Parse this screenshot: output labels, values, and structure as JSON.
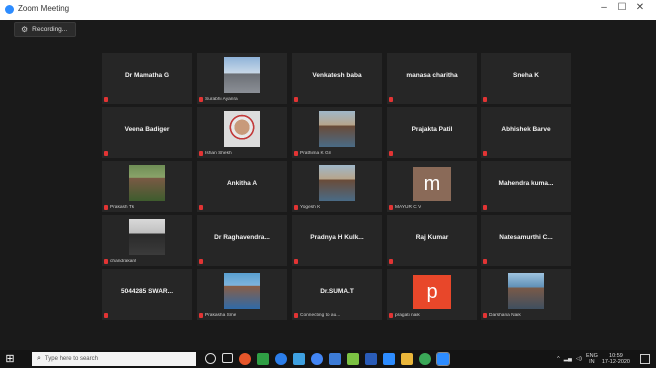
{
  "window": {
    "title": "Zoom Meeting",
    "minimize": "–",
    "maximize": "☐",
    "close": "✕"
  },
  "recording": {
    "label": "Recording..."
  },
  "tiles": [
    {
      "name": "Dr Mamatha G",
      "caption": "",
      "video": ""
    },
    {
      "name": "",
      "caption": "Surabhi Ayanra",
      "video": "tower"
    },
    {
      "name": "Venkatesh baba",
      "caption": "",
      "video": ""
    },
    {
      "name": "manasa charitha",
      "caption": "",
      "video": ""
    },
    {
      "name": "Sneha K",
      "caption": "",
      "video": ""
    },
    {
      "name": "Veena Badiger",
      "caption": "",
      "video": ""
    },
    {
      "name": "",
      "caption": "Ishan Shekh",
      "video": "portrait-frame"
    },
    {
      "name": "",
      "caption": "Prathima K Gn",
      "video": "portrait-outdoor"
    },
    {
      "name": "Prajakta Patil",
      "caption": "",
      "video": ""
    },
    {
      "name": "Abhishek Barve",
      "caption": "",
      "video": ""
    },
    {
      "name": "",
      "caption": "Prakash Tk",
      "video": "portrait-green"
    },
    {
      "name": "Ankitha A",
      "caption": "",
      "video": ""
    },
    {
      "name": "",
      "caption": "Yogesh K",
      "video": "portrait-outdoor"
    },
    {
      "name": "",
      "caption": "MAYUR C V",
      "video": "letter-m"
    },
    {
      "name": "Mahendra kuma...",
      "caption": "",
      "video": ""
    },
    {
      "name": "",
      "caption": "chandrakant",
      "video": "portrait-dark"
    },
    {
      "name": "Dr Raghavendra...",
      "caption": "",
      "video": ""
    },
    {
      "name": "Pradnya H Kulk...",
      "caption": "",
      "video": ""
    },
    {
      "name": "Raj Kumar",
      "caption": "",
      "video": ""
    },
    {
      "name": "Natesamurthi C...",
      "caption": "",
      "video": ""
    },
    {
      "name": "5044285 SWAR...",
      "caption": "",
      "video": ""
    },
    {
      "name": "",
      "caption": "Prakasha Sme",
      "video": "portrait-blue"
    },
    {
      "name": "Dr.SUMA.T",
      "caption": "Connecting to au...",
      "video": ""
    },
    {
      "name": "",
      "caption": "pragati naik",
      "video": "letter-p"
    },
    {
      "name": "",
      "caption": "Darshana Naik",
      "video": "portrait-sea"
    }
  ],
  "avatar_letters": {
    "m": "m",
    "p": "p"
  },
  "taskbar": {
    "search_placeholder": "Type here to search",
    "tray_lang": "ENG",
    "tray_region": "IN",
    "time": "10:59",
    "date": "17-12-2020"
  },
  "colors": {
    "m_avatar": "#8a6a58",
    "p_avatar": "#e8472a",
    "mic_red": "#e23434",
    "accent": "#2d8cff"
  }
}
